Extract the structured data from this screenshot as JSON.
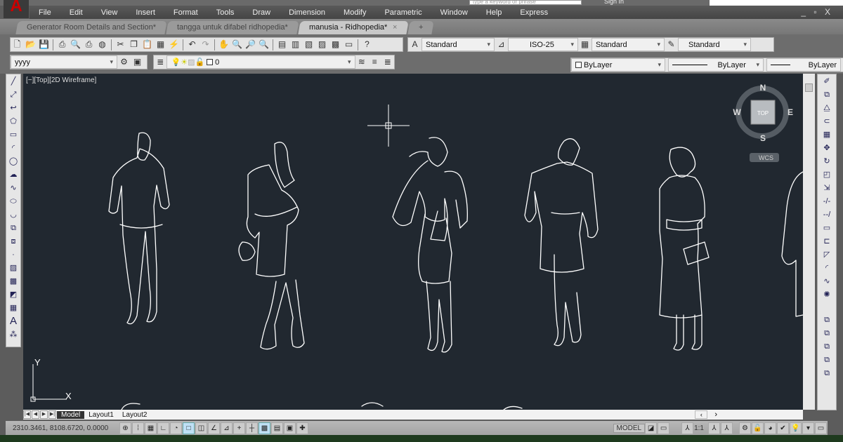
{
  "app": {
    "logo_letter": "A",
    "search_placeholder": "type a keyword or phrase",
    "sign_in": "Sign In",
    "window_controls": "_ ▫ X"
  },
  "menu": [
    "File",
    "Edit",
    "View",
    "Insert",
    "Format",
    "Tools",
    "Draw",
    "Dimension",
    "Modify",
    "Parametric",
    "Window",
    "Help",
    "Express"
  ],
  "tabs": [
    {
      "label": "Generator Room Details and Section*",
      "active": false
    },
    {
      "label": "tangga untuk difabel ridhopedia*",
      "active": false
    },
    {
      "label": "manusia - Ridhopedia*",
      "active": true
    }
  ],
  "styles": {
    "text_style": "Standard",
    "dim_style": "ISO-25",
    "table_style": "Standard",
    "mleader_style": "Standard"
  },
  "workspace": {
    "value": "yyyy"
  },
  "layer": {
    "current": "0"
  },
  "properties": {
    "color": "ByLayer",
    "linetype": "ByLayer",
    "lineweight": "ByLayer"
  },
  "viewport": {
    "label": "[−][Top][2D Wireframe]",
    "background": "#212830"
  },
  "viewcube": {
    "n": "N",
    "s": "S",
    "e": "E",
    "w": "W",
    "top": "TOP",
    "wcs": "WCS"
  },
  "ucs": {
    "x": "X",
    "y": "Y"
  },
  "layout_tabs": [
    {
      "label": "Model",
      "active": true
    },
    {
      "label": "Layout1",
      "active": false
    },
    {
      "label": "Layout2",
      "active": false
    }
  ],
  "status": {
    "coordinates": "2310.3461, 8108.6720, 0.0000",
    "space": "MODEL",
    "annotation_scale": "1:1"
  }
}
